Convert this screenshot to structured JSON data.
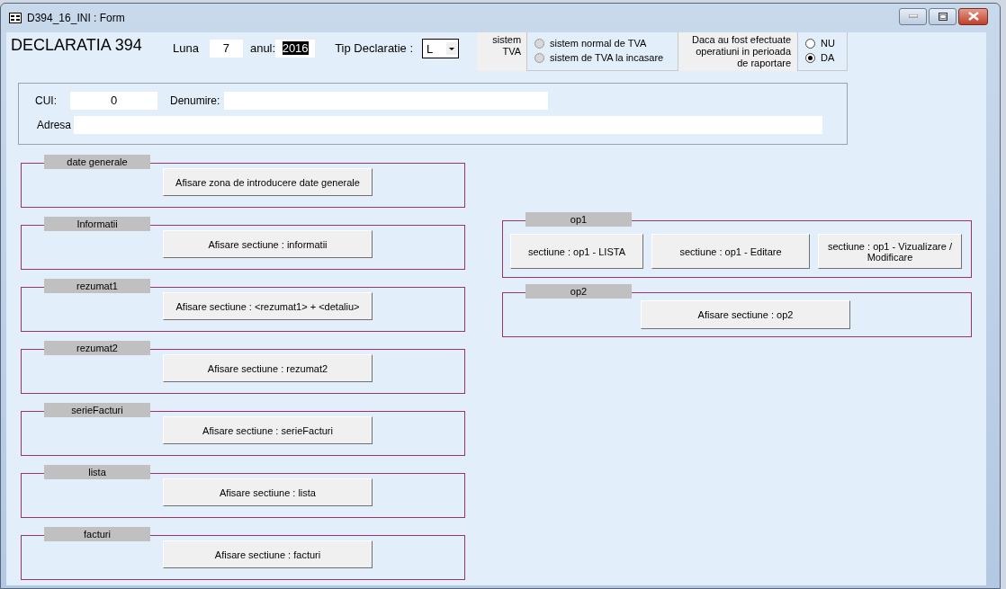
{
  "window": {
    "title": "D394_16_INI : Form"
  },
  "header": {
    "title": "DECLARATIA 394",
    "luna_label": "Luna",
    "luna": "7",
    "anul_label": "anul:",
    "anul": "2016",
    "tip_label": "Tip Declaratie :",
    "tip": "L"
  },
  "tva": {
    "label": "sistem TVA",
    "indeterminate": true,
    "options": [
      {
        "label": "sistem normal de TVA",
        "selected": false
      },
      {
        "label": "sistem de TVA la incasare",
        "selected": false
      }
    ]
  },
  "operatiuni": {
    "label": "Daca au fost efectuate operatiuni in perioada de raportare",
    "options": [
      {
        "label": "NU",
        "selected": false
      },
      {
        "label": "DA",
        "selected": true
      }
    ]
  },
  "identificare": {
    "cui_label": "CUI:",
    "cui": "0",
    "denumire_label": "Denumire:",
    "adresa_label": "Adresa"
  },
  "left_sections": [
    {
      "title": "date generale",
      "buttons": [
        "Afisare zona de introducere date generale"
      ]
    },
    {
      "title": "Informatii",
      "buttons": [
        "Afisare sectiune : informatii"
      ]
    },
    {
      "title": "rezumat1",
      "buttons": [
        "Afisare sectiune : <rezumat1> + <detaliu>"
      ]
    },
    {
      "title": "rezumat2",
      "buttons": [
        "Afisare sectiune : rezumat2"
      ]
    },
    {
      "title": "serieFacturi",
      "buttons": [
        "Afisare sectiune : serieFacturi"
      ]
    },
    {
      "title": "lista",
      "buttons": [
        "Afisare sectiune : lista"
      ]
    },
    {
      "title": "facturi",
      "buttons": [
        "Afisare sectiune : facturi"
      ]
    }
  ],
  "right_sections": [
    {
      "title": "op1",
      "buttons": [
        "sectiune : op1 - LISTA",
        "sectiune : op1 - Editare",
        "sectiune : op1 - Vizualizare / Modificare"
      ]
    },
    {
      "title": "op2",
      "buttons": [
        "Afisare sectiune : op2"
      ]
    }
  ]
}
